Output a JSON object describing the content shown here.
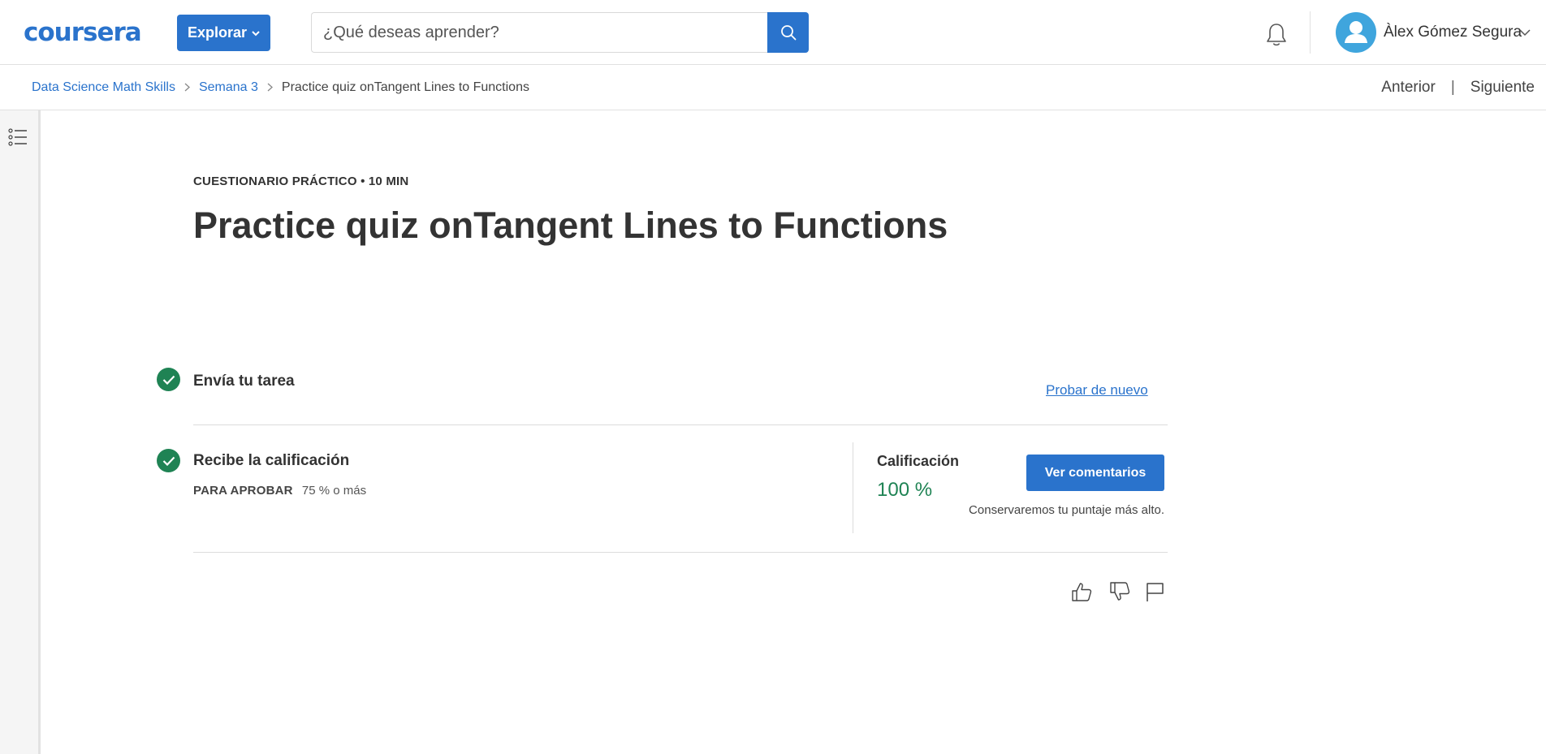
{
  "header": {
    "logo_text": "coursera",
    "explore_label": "Explorar",
    "search_placeholder": "¿Qué deseas aprender?",
    "user_name": "Àlex Gómez Segura"
  },
  "breadcrumb": {
    "items": [
      "Data Science Math Skills",
      "Semana 3",
      "Practice quiz onTangent Lines to Functions"
    ],
    "prev_label": "Anterior",
    "separator": "|",
    "next_label": "Siguiente"
  },
  "main": {
    "eyebrow": "CUESTIONARIO PRÁCTICO • 10 MIN",
    "title": "Practice quiz onTangent Lines to Functions",
    "step1": {
      "title": "Envía tu tarea",
      "retry_label": "Probar de nuevo"
    },
    "step2": {
      "title": "Recibe la calificación",
      "pass_label": "PARA APROBAR",
      "pass_value": "75 % o más",
      "grade_label": "Calificación",
      "grade_value": "100 %",
      "feedback_button": "Ver comentarios",
      "keep_note": "Conservaremos tu puntaje más alto."
    }
  },
  "colors": {
    "brand_blue": "#2a73cc",
    "success_green": "#1f8354",
    "avatar_blue": "#3fa5dd"
  },
  "icons": [
    "search-icon",
    "bell-icon",
    "avatar-icon",
    "chevron-down-icon",
    "list-icon",
    "check-icon",
    "thumbs-up-icon",
    "thumbs-down-icon",
    "flag-icon"
  ]
}
